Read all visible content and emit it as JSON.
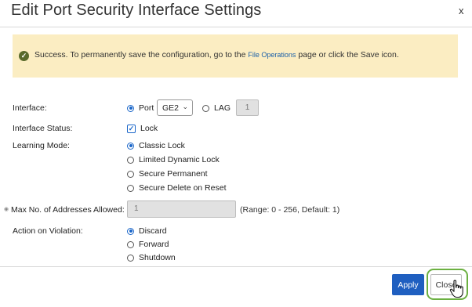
{
  "dialog": {
    "title": "Edit Port Security Interface Settings",
    "close_glyph": "x"
  },
  "alert": {
    "icon": "check-circle-icon",
    "text_before": "Success. To permanently save the configuration, go to the ",
    "link_text": "File Operations",
    "text_after": " page or click the Save icon."
  },
  "form": {
    "interface": {
      "label": "Interface:",
      "port_label": "Port",
      "port_checked": true,
      "port_value": "GE2",
      "lag_label": "LAG",
      "lag_checked": false,
      "lag_value": "1"
    },
    "interface_status": {
      "label": "Interface Status:",
      "lock_label": "Lock",
      "lock_checked": true
    },
    "learning_mode": {
      "label": "Learning Mode:",
      "options": [
        "Classic Lock",
        "Limited Dynamic Lock",
        "Secure Permanent",
        "Secure Delete on Reset"
      ],
      "selected": "Classic Lock"
    },
    "max_addresses": {
      "label": "Max No. of Addresses Allowed:",
      "value": "1",
      "hint": "(Range: 0 - 256, Default: 1)"
    },
    "action_on_violation": {
      "label": "Action on Violation:",
      "options": [
        "Discard",
        "Forward",
        "Shutdown"
      ],
      "selected": "Discard"
    }
  },
  "footer": {
    "apply_label": "Apply",
    "close_label": "Close"
  },
  "colors": {
    "primary": "#1f5fc0",
    "alert_bg": "#fbedc2",
    "success_icon": "#596a2b",
    "highlight_ring": "#6bb041"
  }
}
